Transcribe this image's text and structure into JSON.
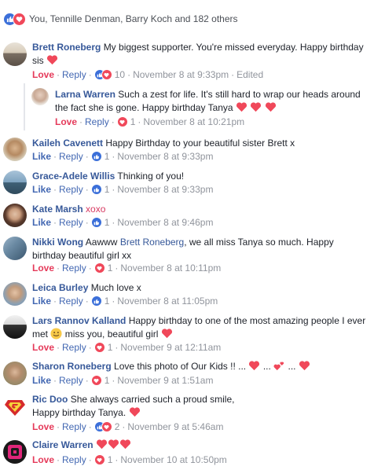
{
  "summary": {
    "text": "You, Tennille Denman, Barry Koch and 182 others"
  },
  "colors": {
    "like": "#3b6fd9",
    "love": "#f0485a",
    "link": "#365899"
  },
  "actions": {
    "love": "Love",
    "like": "Like",
    "reply": "Reply"
  },
  "comments": [
    {
      "name": "Brett Roneberg",
      "text": "My biggest supporter. You're missed everyday. Happy birthday",
      "text2": "sis",
      "reaction": "Love",
      "count": "10",
      "time": "November 8 at 9:33pm",
      "edited": "Edited"
    },
    {
      "name": "Larna Warren",
      "text": "Such a zest for life. It's still hard to wrap our heads around",
      "text2": "the fact she is gone. Happy birthday Tanya",
      "reaction": "Love",
      "count": "1",
      "time": "November 8 at 10:21pm"
    },
    {
      "name": "Kaileh Cavenett",
      "text": "Happy Birthday to your beautiful sister Brett x",
      "reaction": "Like",
      "count": "1",
      "time": "November 8 at 9:33pm"
    },
    {
      "name": "Grace-Adele Willis",
      "text": "Thinking of you!",
      "reaction": "Like",
      "count": "1",
      "time": "November 8 at 9:33pm"
    },
    {
      "name": "Kate Marsh",
      "text": "xoxo",
      "reaction": "Like",
      "count": "1",
      "time": "November 8 at 9:46pm"
    },
    {
      "name": "Nikki Wong",
      "text": "Aawww",
      "mention": "Brett Roneberg",
      "text_after": ", we all miss Tanya so much. Happy",
      "text2": "birthday beautiful girl xx",
      "reaction": "Love",
      "count": "1",
      "time": "November 8 at 10:11pm"
    },
    {
      "name": "Leica Burley",
      "text": "Much love x",
      "reaction": "Like",
      "count": "1",
      "time": "November 8 at 11:05pm"
    },
    {
      "name": "Lars Rannov Kalland",
      "text": "Happy birthday to one of the most amazing people I ever",
      "text2a": "met",
      "text2b": "miss you, beautiful girl",
      "reaction": "Love",
      "count": "1",
      "time": "November 9 at 12:11am"
    },
    {
      "name": "Sharon Roneberg",
      "text": "Love this photo of Our Kids !! ...",
      "sep1": "...",
      "sep2": "...",
      "reaction": "Like",
      "count": "1",
      "time": "November 9 at 1:51am"
    },
    {
      "name": "Ric Doo",
      "text": "She always carried such a proud smile,",
      "text2": "Happy birthday Tanya.",
      "reaction": "Love",
      "count": "2",
      "time": "November 9 at 5:46am"
    },
    {
      "name": "Claire Warren",
      "reaction": "Love",
      "count": "1",
      "time": "November 10 at 10:50pm"
    }
  ]
}
